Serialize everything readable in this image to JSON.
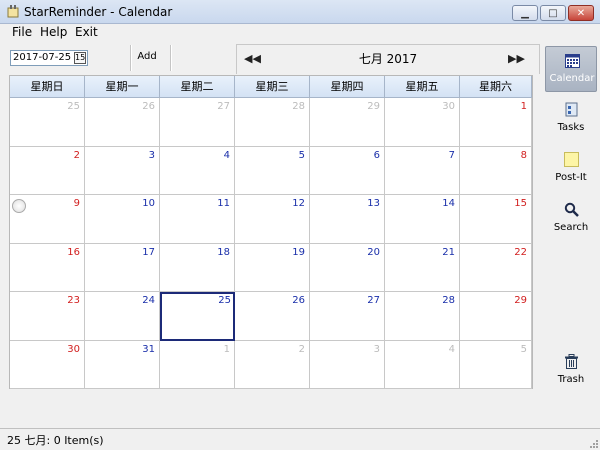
{
  "window": {
    "title": "StarReminder - Calendar",
    "minimize_glyph": "▁",
    "maximize_glyph": "□",
    "close_glyph": "✕"
  },
  "menu": [
    "File",
    "Help",
    "Exit"
  ],
  "toolbar": {
    "date_value": "2017-07-25",
    "date_picker_glyph": "15",
    "add_label": "Add",
    "prev_glyph": "◀◀",
    "next_glyph": "▶▶",
    "month_title": "七月 2017"
  },
  "calendar": {
    "weekdays": [
      "星期日",
      "星期一",
      "星期二",
      "星期三",
      "星期四",
      "星期五",
      "星期六"
    ],
    "weeks": [
      [
        {
          "d": "25",
          "t": "other"
        },
        {
          "d": "26",
          "t": "other"
        },
        {
          "d": "27",
          "t": "other"
        },
        {
          "d": "28",
          "t": "other"
        },
        {
          "d": "29",
          "t": "other"
        },
        {
          "d": "30",
          "t": "other"
        },
        {
          "d": "1",
          "t": "weekend"
        }
      ],
      [
        {
          "d": "2",
          "t": "weekend"
        },
        {
          "d": "3",
          "t": "weekday"
        },
        {
          "d": "4",
          "t": "weekday"
        },
        {
          "d": "5",
          "t": "weekday"
        },
        {
          "d": "6",
          "t": "weekday"
        },
        {
          "d": "7",
          "t": "weekday"
        },
        {
          "d": "8",
          "t": "weekend"
        }
      ],
      [
        {
          "d": "9",
          "t": "weekend",
          "icon": "clock-icon"
        },
        {
          "d": "10",
          "t": "weekday"
        },
        {
          "d": "11",
          "t": "weekday"
        },
        {
          "d": "12",
          "t": "weekday"
        },
        {
          "d": "13",
          "t": "weekday"
        },
        {
          "d": "14",
          "t": "weekday"
        },
        {
          "d": "15",
          "t": "weekend"
        }
      ],
      [
        {
          "d": "16",
          "t": "weekend"
        },
        {
          "d": "17",
          "t": "weekday"
        },
        {
          "d": "18",
          "t": "weekday"
        },
        {
          "d": "19",
          "t": "weekday"
        },
        {
          "d": "20",
          "t": "weekday"
        },
        {
          "d": "21",
          "t": "weekday"
        },
        {
          "d": "22",
          "t": "weekend"
        }
      ],
      [
        {
          "d": "23",
          "t": "weekend"
        },
        {
          "d": "24",
          "t": "weekday"
        },
        {
          "d": "25",
          "t": "weekday",
          "selected": true
        },
        {
          "d": "26",
          "t": "weekday"
        },
        {
          "d": "27",
          "t": "weekday"
        },
        {
          "d": "28",
          "t": "weekday"
        },
        {
          "d": "29",
          "t": "weekend"
        }
      ],
      [
        {
          "d": "30",
          "t": "weekend"
        },
        {
          "d": "31",
          "t": "weekday"
        },
        {
          "d": "1",
          "t": "other"
        },
        {
          "d": "2",
          "t": "other"
        },
        {
          "d": "3",
          "t": "other"
        },
        {
          "d": "4",
          "t": "other"
        },
        {
          "d": "5",
          "t": "other"
        }
      ]
    ]
  },
  "sidebar": {
    "items": [
      {
        "key": "calendar",
        "label": "Calendar",
        "icon": "calendar-icon",
        "active": true
      },
      {
        "key": "tasks",
        "label": "Tasks",
        "icon": "tasks-icon",
        "active": false
      },
      {
        "key": "postit",
        "label": "Post-It",
        "icon": "post-it-icon",
        "active": false
      },
      {
        "key": "search",
        "label": "Search",
        "icon": "search-icon",
        "active": false
      }
    ],
    "trash_label": "Trash"
  },
  "status": {
    "text": "25 七月: 0 Item(s)"
  },
  "colors": {
    "weekday_text": "#1a2faa",
    "weekend_text": "#d22020",
    "other_month_text": "#bcbcbc",
    "selected_border": "#1c2a78",
    "header_bg": "#d4e2f4"
  }
}
